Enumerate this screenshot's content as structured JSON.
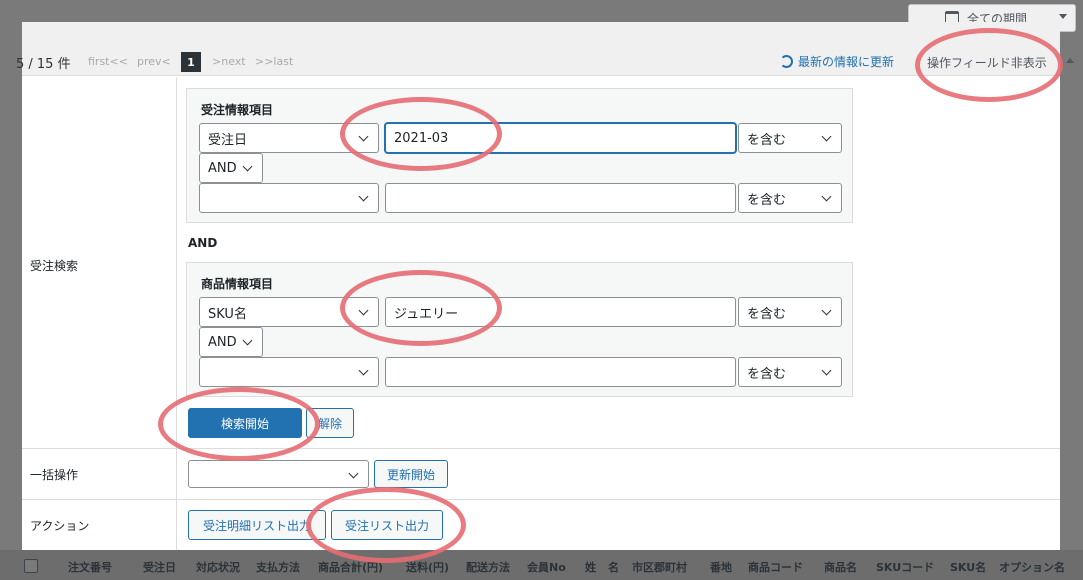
{
  "toolbar": {
    "period_label": "全ての期間"
  },
  "pager": {
    "count_text": "5 / 15 件",
    "first": "first<<",
    "prev": "prev<",
    "current_page": "1",
    "next": ">next",
    "last": ">>last",
    "refresh_label": "最新の情報に更新",
    "hide_fields_label": "操作フィールド非表示"
  },
  "order_search": {
    "row_label": "受注検索",
    "order_group": {
      "title": "受注情報項目",
      "field1": "受注日",
      "value1": "2021-03",
      "match1": "を含む",
      "logic": "AND",
      "field2": "",
      "value2": "",
      "match2": "を含む"
    },
    "between_logic": "AND",
    "item_group": {
      "title": "商品情報項目",
      "field1": "SKU名",
      "value1": "ジュエリー",
      "match1": "を含む",
      "logic": "AND",
      "field2": "",
      "value2": "",
      "match2": "を含む"
    },
    "search_button": "検索開始",
    "clear_button": "解除"
  },
  "bulk": {
    "row_label": "一括操作",
    "select_value": "",
    "update_button": "更新開始"
  },
  "action": {
    "row_label": "アクション",
    "detail_export_button": "受注明細リスト出力",
    "list_export_button": "受注リスト出力"
  },
  "table_columns": [
    "注文番号",
    "受注日",
    "対応状況",
    "支払方法",
    "商品合計(円)",
    "送料(円)",
    "配送方法",
    "会員No",
    "姓",
    "名",
    "市区郡町村",
    "番地",
    "商品コード",
    "商品名",
    "SKUコード",
    "SKU名",
    "オプション名"
  ],
  "colors": {
    "accent": "#2271b1",
    "annotation": "#e66b72",
    "overlay": "#7a7a7a"
  },
  "icons": [
    "calendar-icon",
    "refresh-icon",
    "chevron-down-icon",
    "caret-up-icon"
  ]
}
